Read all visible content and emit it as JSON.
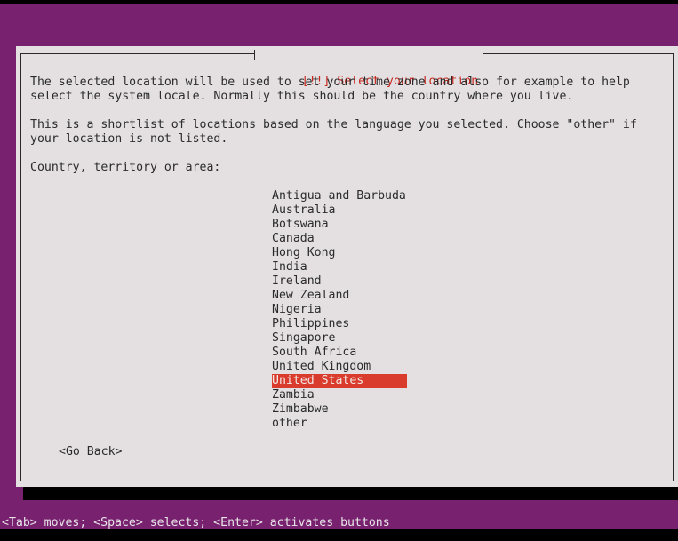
{
  "dialog": {
    "title": "[!!] Select your location",
    "description_lines": [
      "The selected location will be used to set your time zone and also for example to help",
      "select the system locale. Normally this should be the country where you live."
    ],
    "shortlist_lines": [
      "This is a shortlist of locations based on the language you selected. Choose \"other\" if",
      "your location is not listed."
    ],
    "prompt": "Country, territory or area:",
    "countries": [
      {
        "label": "Antigua and Barbuda"
      },
      {
        "label": "Australia"
      },
      {
        "label": "Botswana"
      },
      {
        "label": "Canada"
      },
      {
        "label": "Hong Kong"
      },
      {
        "label": "India"
      },
      {
        "label": "Ireland"
      },
      {
        "label": "New Zealand"
      },
      {
        "label": "Nigeria"
      },
      {
        "label": "Philippines"
      },
      {
        "label": "Singapore"
      },
      {
        "label": "South Africa"
      },
      {
        "label": "United Kingdom"
      },
      {
        "label": "United States"
      },
      {
        "label": "Zambia"
      },
      {
        "label": "Zimbabwe"
      },
      {
        "label": "other"
      }
    ],
    "selected_country": "United States",
    "go_back_label": "<Go Back>"
  },
  "status_bar": {
    "text": "<Tab> moves; <Space> selects; <Enter> activates buttons"
  },
  "colors": {
    "background_purple": "#77216f",
    "dialog_background": "#e4e0e2",
    "title_red": "#c8281e",
    "selection_red": "#d93c2c"
  }
}
